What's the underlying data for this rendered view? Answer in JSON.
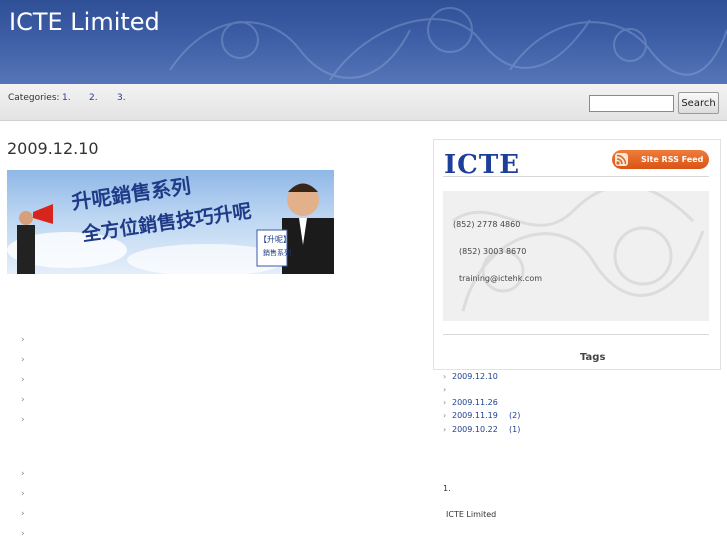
{
  "header": {
    "site_title": "ICTE Limited"
  },
  "categories": {
    "label": "Categories:",
    "links": [
      "1.",
      "2.",
      "3."
    ]
  },
  "search": {
    "placeholder": "",
    "button_label": "Search"
  },
  "post": {
    "date": "2009.12.10",
    "banner": {
      "line1": "升呢銷售系列",
      "line2": "全方位銷售技巧升呢",
      "book_label": "【升呢】",
      "book_sub": "銷售系列"
    },
    "bullets_top_count": 5,
    "bullets_bottom_count": 4,
    "bullet_glyph": "›"
  },
  "sidebar": {
    "logo_text": "ICTE",
    "rss_label": "Site RSS Feed",
    "contact": {
      "phone1": "(852) 2778 4860",
      "phone2": "(852) 3003 8670",
      "email": "training@ictehk.com"
    },
    "tags_title": "Tags",
    "tags": [
      {
        "label": "2009.12.10",
        "count": ""
      },
      {
        "label": "",
        "count": ""
      },
      {
        "label": "2009.11.26",
        "count": ""
      },
      {
        "label": "2009.11.19",
        "count": "(2)"
      },
      {
        "label": "2009.10.22",
        "count": "(1)"
      }
    ]
  },
  "footer": {
    "number": "1.",
    "company": "ICTE Limited"
  },
  "colors": {
    "header_blue": "#3d5ea6",
    "link_blue": "#1f3f8f",
    "rss_orange": "#e0631f",
    "logo_blue": "#1d3f9a"
  }
}
